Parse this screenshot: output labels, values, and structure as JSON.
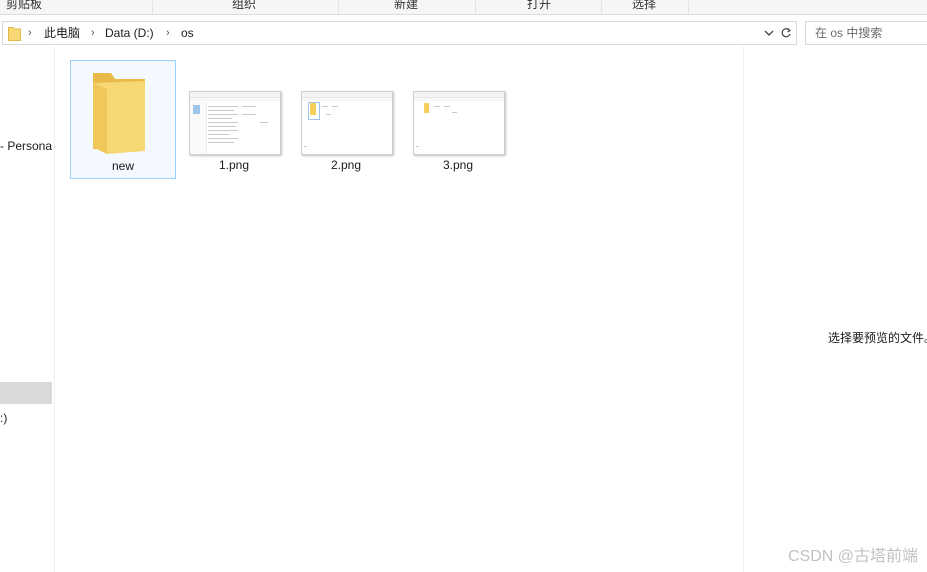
{
  "ribbon": {
    "groups": [
      "剪贴板",
      "组织",
      "新建",
      "打开",
      "选择"
    ]
  },
  "address_bar": {
    "folder_icon": "folder-icon",
    "crumbs": [
      "此电脑",
      "Data (D:)",
      "os"
    ],
    "refresh_icon": "refresh-icon"
  },
  "search": {
    "placeholder": "在 os 中搜索"
  },
  "nav": {
    "items": [
      "- Persona",
      ":)"
    ]
  },
  "files": [
    {
      "name": "new",
      "icon": "folder-icon",
      "selected": true
    },
    {
      "name": "1.png",
      "icon": "image-thumbnail",
      "selected": false
    },
    {
      "name": "2.png",
      "icon": "image-thumbnail",
      "selected": false
    },
    {
      "name": "3.png",
      "icon": "image-thumbnail",
      "selected": false
    }
  ],
  "preview": {
    "message": "选择要预览的文件。"
  },
  "watermark": "CSDN @古塔前端",
  "colors": {
    "folder": "#f8d775",
    "selection_border": "#99d1ff",
    "selection_fill": "#f3f9ff"
  }
}
